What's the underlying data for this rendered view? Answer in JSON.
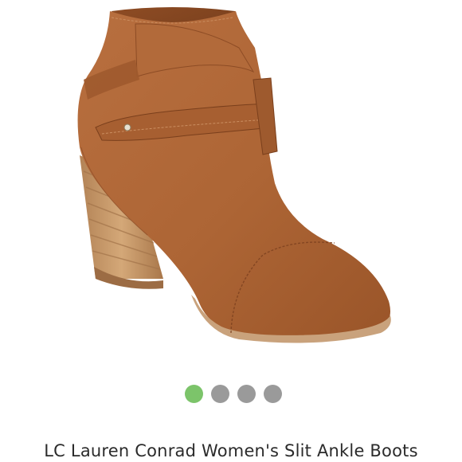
{
  "product": {
    "title": "LC Lauren Conrad Women's Slit Ankle Boots",
    "image_icon": "ankle-boot-photo"
  },
  "carousel": {
    "total": 4,
    "active_index": 0,
    "active_color": "#7cc46a",
    "inactive_color": "#9a9a9a"
  },
  "colors": {
    "leather": "#b0683a",
    "heel": "#c89a6c",
    "background": "#ffffff"
  }
}
